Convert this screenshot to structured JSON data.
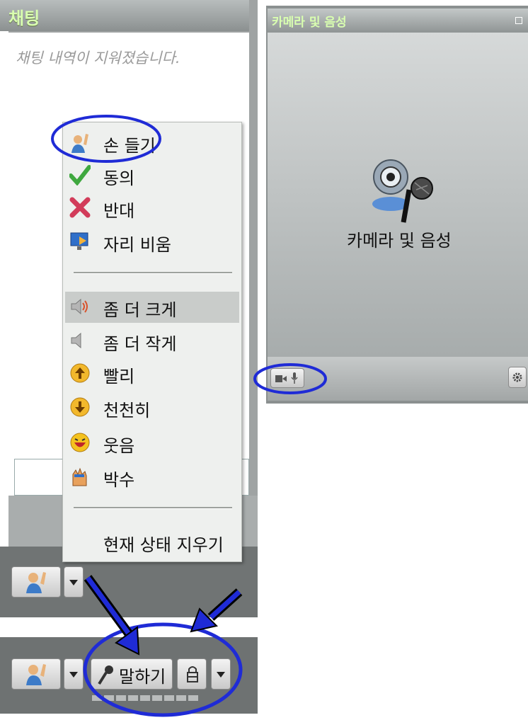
{
  "chat": {
    "title": "채팅",
    "cleared_message": "채팅 내역이 지워졌습니다."
  },
  "status_menu": {
    "items": [
      {
        "label": "손 들기",
        "icon": "raise-hand-icon"
      },
      {
        "label": "동의",
        "icon": "checkmark-icon"
      },
      {
        "label": "반대",
        "icon": "x-icon"
      },
      {
        "label": "자리 비움",
        "icon": "away-monitor-icon"
      },
      {
        "label": "좀 더 크게",
        "icon": "speaker-loud-icon",
        "highlighted": true
      },
      {
        "label": "좀 더 작게",
        "icon": "speaker-soft-icon"
      },
      {
        "label": "빨리",
        "icon": "arrow-up-icon"
      },
      {
        "label": "천천히",
        "icon": "arrow-down-icon"
      },
      {
        "label": "웃음",
        "icon": "laugh-face-icon"
      },
      {
        "label": "박수",
        "icon": "clapping-hands-icon"
      }
    ],
    "clear_label": "현재 상태 지우기"
  },
  "toolbar": {
    "speak_label": "말하기"
  },
  "camera_panel": {
    "title": "카메라 및 음성",
    "center_label": "카메라 및 음성"
  },
  "colors": {
    "annotation": "#1f2bd6",
    "panel_title": "#d9ffb0",
    "menu_highlight": "#c9ccca"
  }
}
